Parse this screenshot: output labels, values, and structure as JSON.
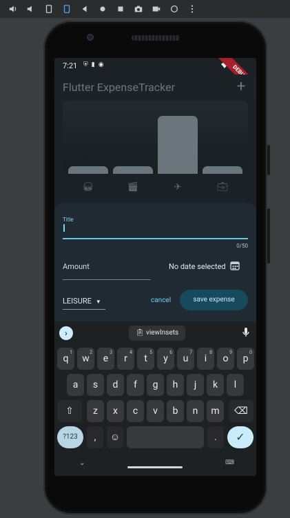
{
  "toolbar": {
    "icons": [
      "volume-up-icon",
      "volume-down-icon",
      "rotate-left-icon",
      "rotate-right-icon",
      "back-icon",
      "home-icon",
      "overview-icon",
      "camera-icon",
      "video-icon",
      "replay-icon",
      "more-icon"
    ]
  },
  "status": {
    "time": "7:21",
    "debug_label": "DEBUG"
  },
  "app": {
    "title": "Flutter ExpenseTracker",
    "add_symbol": "+"
  },
  "chart_data": {
    "type": "bar",
    "categories": [
      "food",
      "leisure",
      "travel",
      "work"
    ],
    "values": [
      0.1,
      0.1,
      1.0,
      0.1
    ],
    "ylim": [
      0,
      1
    ]
  },
  "form": {
    "title_label": "Title",
    "title_value": "",
    "counter": "0/50",
    "amount_label": "Amount",
    "date_text": "No date selected",
    "category_value": "LEISURE",
    "cancel_label": "cancel",
    "save_label": "save expense"
  },
  "keyboard": {
    "suggestion_chip": "viewInsets",
    "row1": [
      "q",
      "w",
      "e",
      "r",
      "t",
      "y",
      "u",
      "i",
      "o",
      "p"
    ],
    "row1_digits": [
      "1",
      "2",
      "3",
      "4",
      "5",
      "6",
      "7",
      "8",
      "9",
      "0"
    ],
    "row2": [
      "a",
      "s",
      "d",
      "f",
      "g",
      "h",
      "j",
      "k",
      "l"
    ],
    "row3": [
      "z",
      "x",
      "c",
      "v",
      "b",
      "n",
      "m"
    ],
    "symbols_key": "?123",
    "comma_key": ",",
    "period_key": "."
  },
  "colors": {
    "accent": "#7fd3f1",
    "save_button_bg": "#174a5c",
    "sheet_bg": "#1f2a32"
  }
}
